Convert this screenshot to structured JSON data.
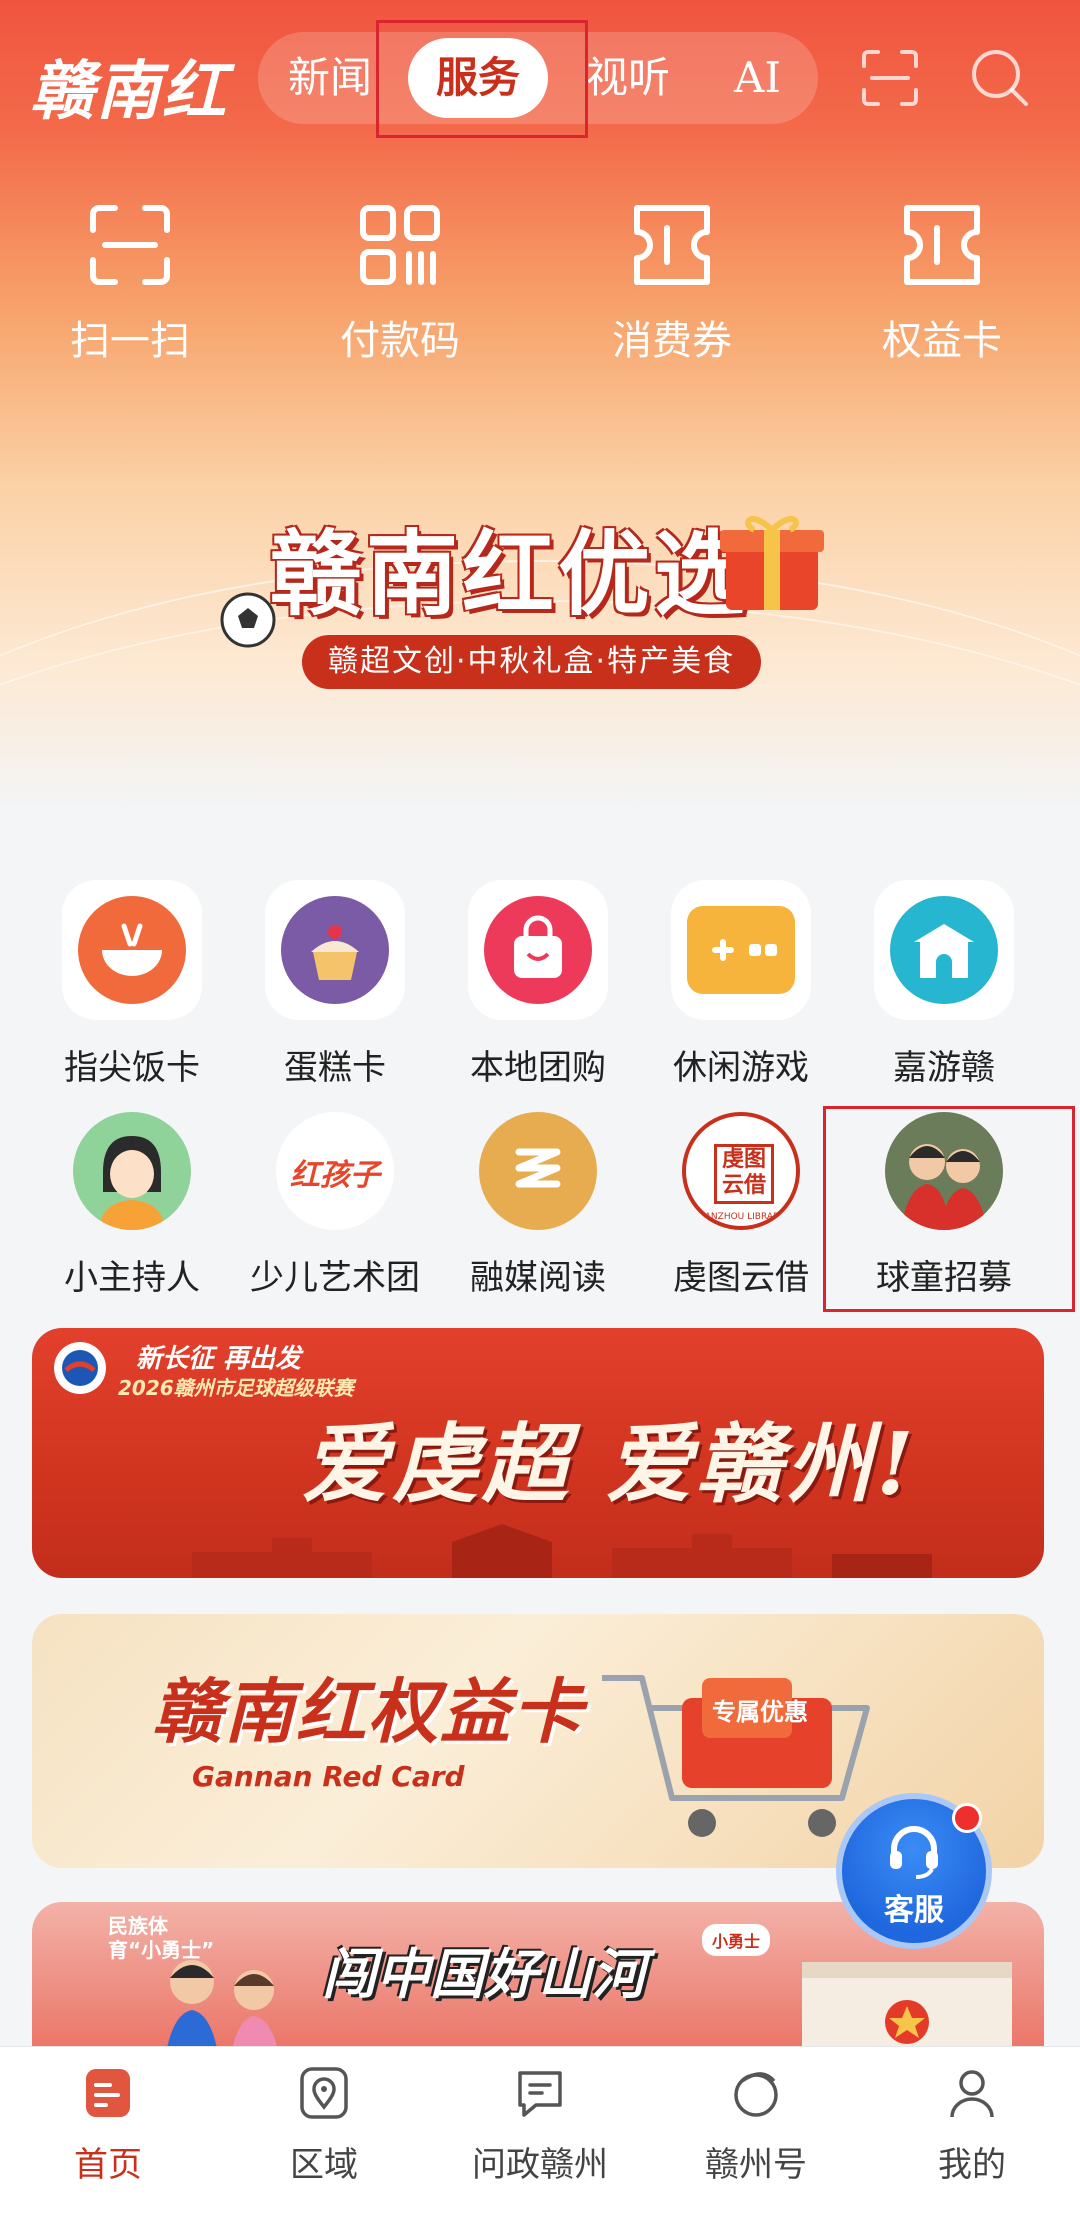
{
  "header": {
    "logo_text": "赣南红",
    "tabs": [
      {
        "label": "新闻",
        "active": false
      },
      {
        "label": "服务",
        "active": true
      },
      {
        "label": "视听",
        "active": false
      },
      {
        "label": "AI",
        "active": false
      }
    ],
    "icons": [
      "scan-icon",
      "search-icon"
    ]
  },
  "quick_actions": [
    {
      "label": "扫一扫",
      "icon": "scan-icon"
    },
    {
      "label": "付款码",
      "icon": "qrcode-icon"
    },
    {
      "label": "消费券",
      "icon": "coupon-icon"
    },
    {
      "label": "权益卡",
      "icon": "ticket-icon"
    }
  ],
  "hero_banner": {
    "title": "赣南红优选",
    "subtitle": "赣超文创·中秋礼盒·特产美食"
  },
  "services_row1": [
    {
      "label": "指尖饭卡",
      "icon": "rice-bowl-icon",
      "color": "#f06a3c"
    },
    {
      "label": "蛋糕卡",
      "icon": "cake-icon",
      "color": "#7b5aa6"
    },
    {
      "label": "本地团购",
      "icon": "shopping-bag-icon",
      "color": "#ee3a5a"
    },
    {
      "label": "休闲游戏",
      "icon": "gamepad-icon",
      "color": "#f7b43c"
    },
    {
      "label": "嘉游赣",
      "icon": "gate-icon",
      "color": "#27b6cf"
    }
  ],
  "services_row2": [
    {
      "label": "小主持人",
      "icon": "host-girl-icon"
    },
    {
      "label": "少儿艺术团",
      "icon": "red-kid-logo-icon",
      "logo_text": "红孩子"
    },
    {
      "label": "融媒阅读",
      "icon": "reading-icon"
    },
    {
      "label": "虔图云借",
      "icon": "library-seal-icon",
      "seal_text": "虔图云借",
      "seal_ring": "GANZHOU LIBRARY"
    },
    {
      "label": "球童招募",
      "icon": "ball-kids-icon"
    }
  ],
  "promo_cards": [
    {
      "name": "ganzhou-super-league-banner",
      "top_text": "新长征 再出发",
      "sub_text": "2026赣州市足球超级联赛",
      "title": "爱虔超 爱赣州!"
    },
    {
      "name": "red-card-banner",
      "title": "赣南红权益卡",
      "sub_text": "Gannan Red Card",
      "tag": "专属优惠"
    },
    {
      "name": "ethnic-sports-banner",
      "tag": "民族体育“小勇士”",
      "title": "闯中国好山河",
      "badge": "小勇士"
    }
  ],
  "fab": {
    "label": "客服",
    "icon": "headset-icon"
  },
  "tabbar": [
    {
      "label": "首页",
      "icon": "home-icon",
      "active": true
    },
    {
      "label": "区域",
      "icon": "location-icon",
      "active": false
    },
    {
      "label": "问政赣州",
      "icon": "chat-icon",
      "active": false
    },
    {
      "label": "赣州号",
      "icon": "planet-icon",
      "active": false
    },
    {
      "label": "我的",
      "icon": "user-icon",
      "active": false
    }
  ],
  "colors": {
    "brand_red": "#c9301b",
    "highlight_box": "#d9252f",
    "fab_blue": "#1f67de"
  }
}
